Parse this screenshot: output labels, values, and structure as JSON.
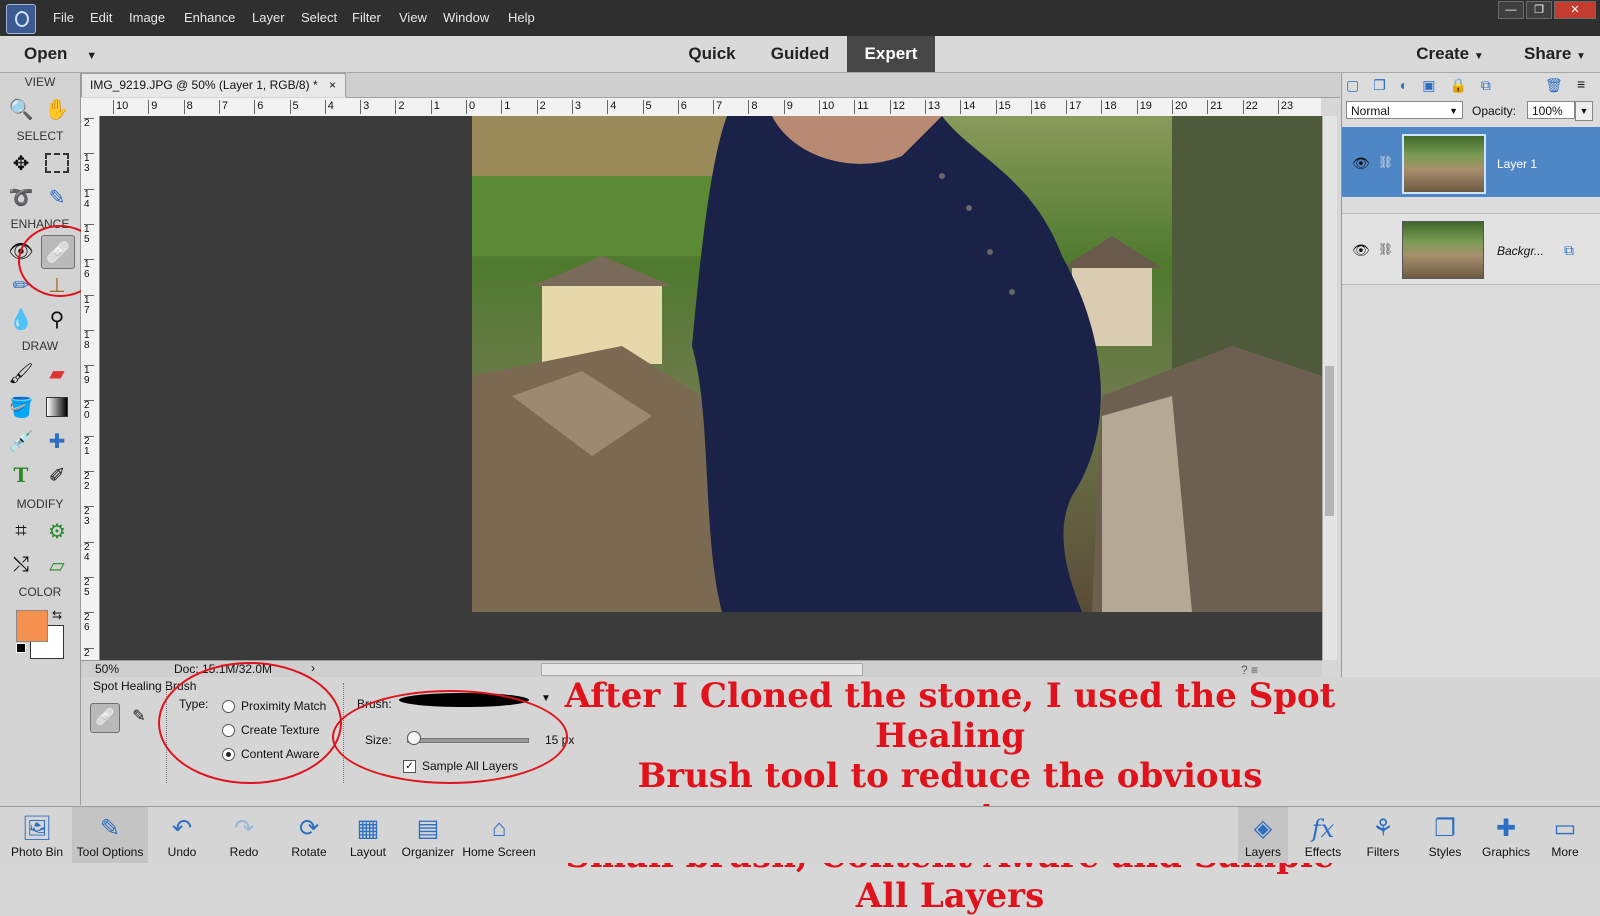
{
  "menu": [
    "File",
    "Edit",
    "Image",
    "Enhance",
    "Layer",
    "Select",
    "Filter",
    "View",
    "Window",
    "Help"
  ],
  "window_buttons": [
    "—",
    "❐",
    "✕"
  ],
  "modebar": {
    "open": "Open",
    "quick": "Quick",
    "guided": "Guided",
    "expert": "Expert",
    "create": "Create",
    "share": "Share"
  },
  "toolpanel": {
    "view": "VIEW",
    "select": "SELECT",
    "enhance": "ENHANCE",
    "draw": "DRAW",
    "modify": "MODIFY",
    "color": "COLOR",
    "fg_color": "#f5924f",
    "bg_color": "#ffffff"
  },
  "document": {
    "tab_title": "IMG_9219.JPG @ 50% (Layer 1, RGB/8) *",
    "close": "×",
    "zoom": "50%",
    "doc_size": "Doc: 15.1M/32.0M"
  },
  "ruler_top": [
    "10",
    "9",
    "8",
    "7",
    "6",
    "5",
    "4",
    "3",
    "2",
    "1",
    "0",
    "1",
    "2",
    "3",
    "4",
    "5",
    "6",
    "7",
    "8",
    "9",
    "10",
    "11",
    "12",
    "13",
    "14",
    "15",
    "16",
    "17",
    "18",
    "19",
    "20",
    "21",
    "22",
    "23"
  ],
  "ruler_left": [
    "2",
    "1 3",
    "1 4",
    "1 5",
    "1 6",
    "1 7",
    "1 8",
    "1 9",
    "2 0",
    "2 1",
    "2 2",
    "2 3",
    "2 4",
    "2 5",
    "2 6",
    "2"
  ],
  "layers_panel": {
    "blend_mode": "Normal",
    "opacity_label": "Opacity:",
    "opacity_value": "100%",
    "layers": [
      {
        "name": "Layer 1",
        "selected": true
      },
      {
        "name": "Backgr...",
        "selected": false
      }
    ]
  },
  "tool_options": {
    "tool_name": "Spot Healing Brush",
    "type_label": "Type:",
    "types": [
      "Proximity Match",
      "Create Texture",
      "Content Aware"
    ],
    "selected_type": "Content Aware",
    "brush_label": "Brush:",
    "size_label": "Size:",
    "size_value": "15 px",
    "size_fraction": 0.05,
    "sample_all_layers": "Sample All Layers",
    "sample_checked": true
  },
  "annotation": {
    "line1": "After I Cloned the stone, I used the Spot Healing",
    "line2": "Brush tool to reduce the obvious repeats.",
    "line3": "Small brush, Content Aware and Sample All Layers",
    "color": "#e0121b"
  },
  "bottombar_left": [
    "Photo Bin",
    "Tool Options",
    "Undo",
    "Redo",
    "Rotate",
    "Layout",
    "Organizer",
    "Home Screen"
  ],
  "bottombar_right": [
    "Layers",
    "Effects",
    "Filters",
    "Styles",
    "Graphics",
    "More"
  ]
}
